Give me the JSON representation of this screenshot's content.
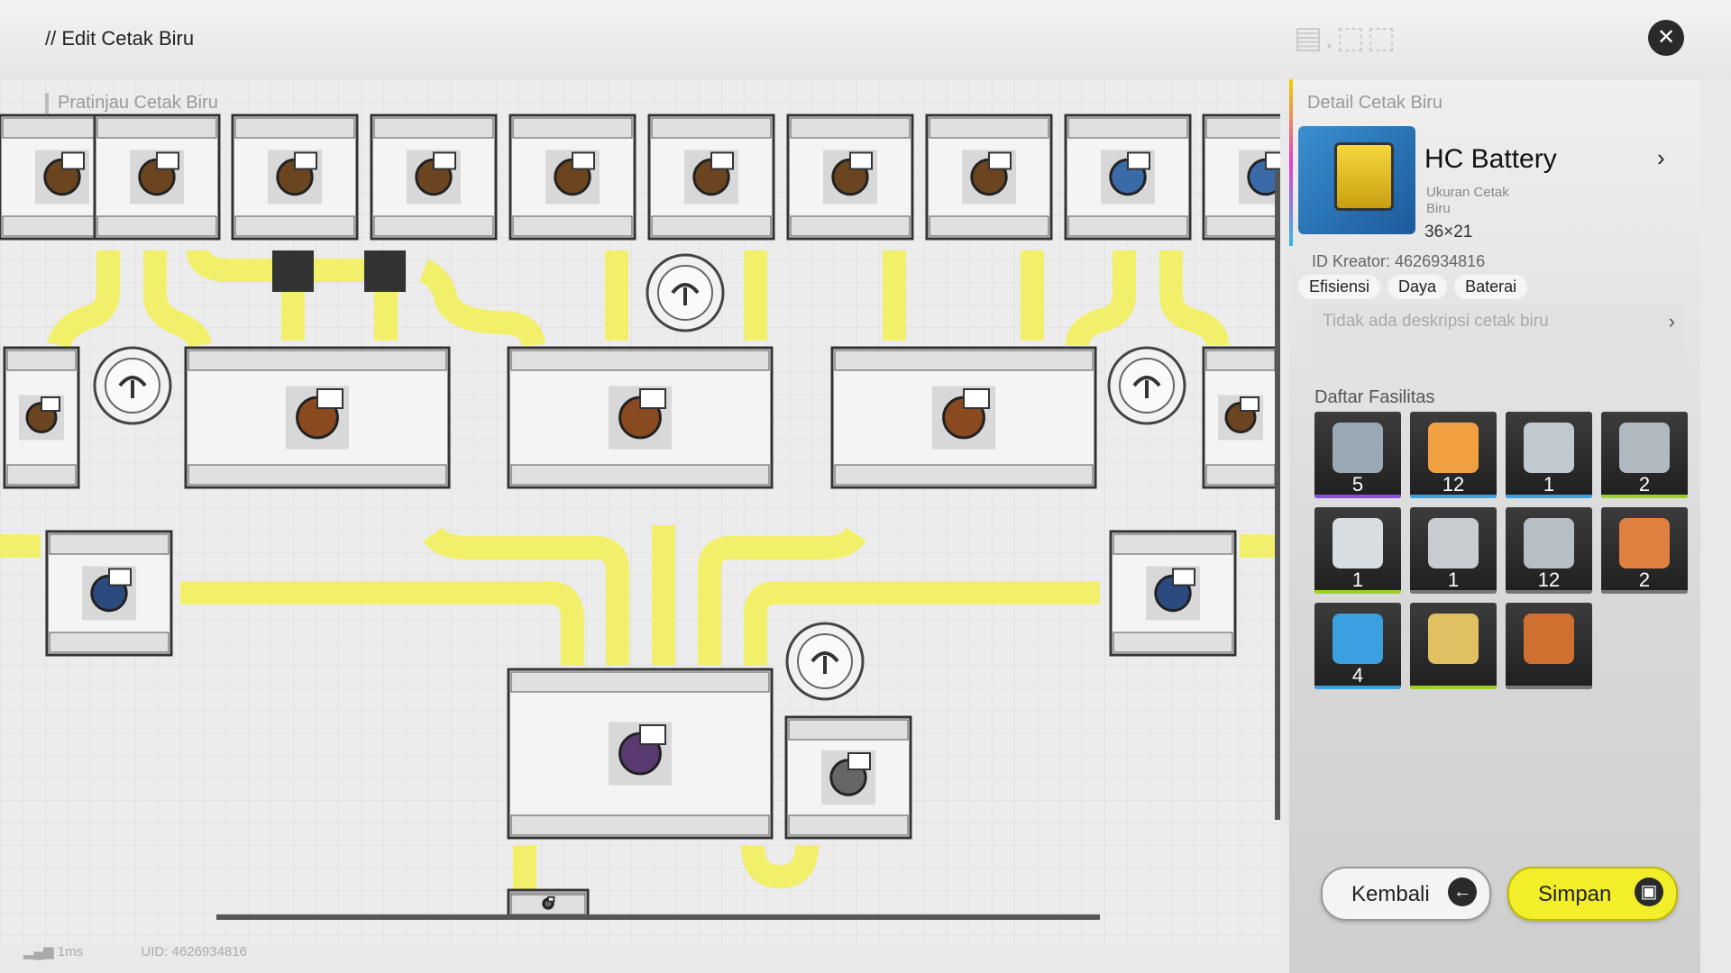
{
  "header": {
    "title": "Edit Cetak Biru",
    "close_icon": "close-icon"
  },
  "preview": {
    "label": "Pratinjau Cetak Biru"
  },
  "status": {
    "latency": "1ms",
    "uid": "UID: 4626934816"
  },
  "detail": {
    "label": "Detail Cetak Biru",
    "name": "HC Battery",
    "size_label": "Ukuran Cetak Biru",
    "size_value": "36×21",
    "creator": "ID Kreator: 4626934816",
    "tags": [
      "Efisiensi",
      "Daya",
      "Baterai"
    ],
    "description": "Tidak ada deskripsi cetak biru"
  },
  "facilities": {
    "label": "Daftar Fasilitas",
    "items": [
      {
        "icon": "refining-unit-icon",
        "count": "5",
        "accent": "#8a4fe0"
      },
      {
        "icon": "shredding-unit-icon",
        "count": "12",
        "accent": "#3aa0e0"
      },
      {
        "icon": "moulding-unit-icon",
        "count": "1",
        "accent": "#3aa0e0"
      },
      {
        "icon": "filling-unit-icon",
        "count": "2",
        "accent": "#9ad22a"
      },
      {
        "icon": "power-pylon-icon",
        "count": "1",
        "accent": "#9ad22a"
      },
      {
        "icon": "storage-unit-icon",
        "count": "1",
        "accent": "#777777"
      },
      {
        "icon": "protocol-core-icon",
        "count": "12",
        "accent": "#777777"
      },
      {
        "icon": "packaging-unit-icon",
        "count": "2",
        "accent": "#777777"
      },
      {
        "icon": "relay-tower-icon",
        "count": "4",
        "accent": "#3aa0e0"
      },
      {
        "icon": "conveyor-splitter-icon",
        "count": "",
        "accent": "#9ad22a"
      },
      {
        "icon": "floor-tile-icon",
        "count": "",
        "accent": "#777777"
      }
    ]
  },
  "buttons": {
    "back": "Kembali",
    "save": "Simpan"
  }
}
